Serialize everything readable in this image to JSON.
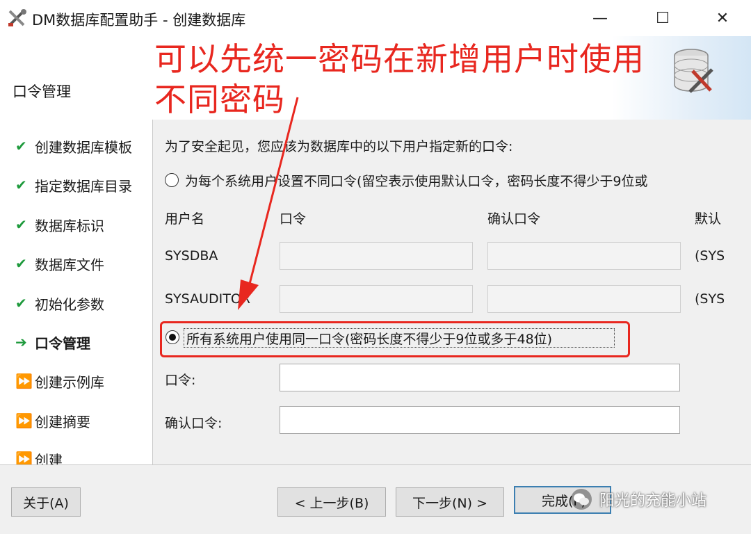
{
  "window": {
    "title": "DM数据库配置助手 - 创建数据库",
    "minimize": "—",
    "maximize": "☐",
    "close": "✕"
  },
  "header": {
    "title": "口令管理"
  },
  "annotation": {
    "line1": "可以先统一密码在新增用户时使用",
    "line2": "不同密码",
    "color": "#e8271f"
  },
  "sidebar": {
    "steps": [
      {
        "label": "创建数据库模板",
        "status": "done",
        "icon": "✔"
      },
      {
        "label": "指定数据库目录",
        "status": "done",
        "icon": "✔"
      },
      {
        "label": "数据库标识",
        "status": "done",
        "icon": "✔"
      },
      {
        "label": "数据库文件",
        "status": "done",
        "icon": "✔"
      },
      {
        "label": "初始化参数",
        "status": "done",
        "icon": "✔"
      },
      {
        "label": "口令管理",
        "status": "current",
        "icon": "➔"
      },
      {
        "label": "创建示例库",
        "status": "pending",
        "icon": "⏩"
      },
      {
        "label": "创建摘要",
        "status": "pending",
        "icon": "⏩"
      },
      {
        "label": "创建",
        "status": "pending",
        "icon": "⏩"
      }
    ]
  },
  "main": {
    "intro": "为了安全起见，您应该为数据库中的以下用户指定新的口令:",
    "option_separate": "为每个系统用户设置不同口令(留空表示使用默认口令，密码长度不得少于9位或",
    "columns": {
      "username": "用户名",
      "password": "口令",
      "confirm": "确认口令",
      "default": "默认"
    },
    "rows": [
      {
        "username": "SYSDBA",
        "default": "(SYS"
      },
      {
        "username": "SYSAUDITOR",
        "default": "(SYS"
      }
    ],
    "option_same": "所有系统用户使用同一口令(密码长度不得少于9位或多于48位)",
    "password_label": "口令:",
    "confirm_label": "确认口令:",
    "password_value": "",
    "confirm_value": ""
  },
  "footer": {
    "about": "关于(A)",
    "prev": "< 上一步(B)",
    "next": "下一步(N) >",
    "finish": "完成(F)",
    "watermark": "阳光的充能小站"
  }
}
